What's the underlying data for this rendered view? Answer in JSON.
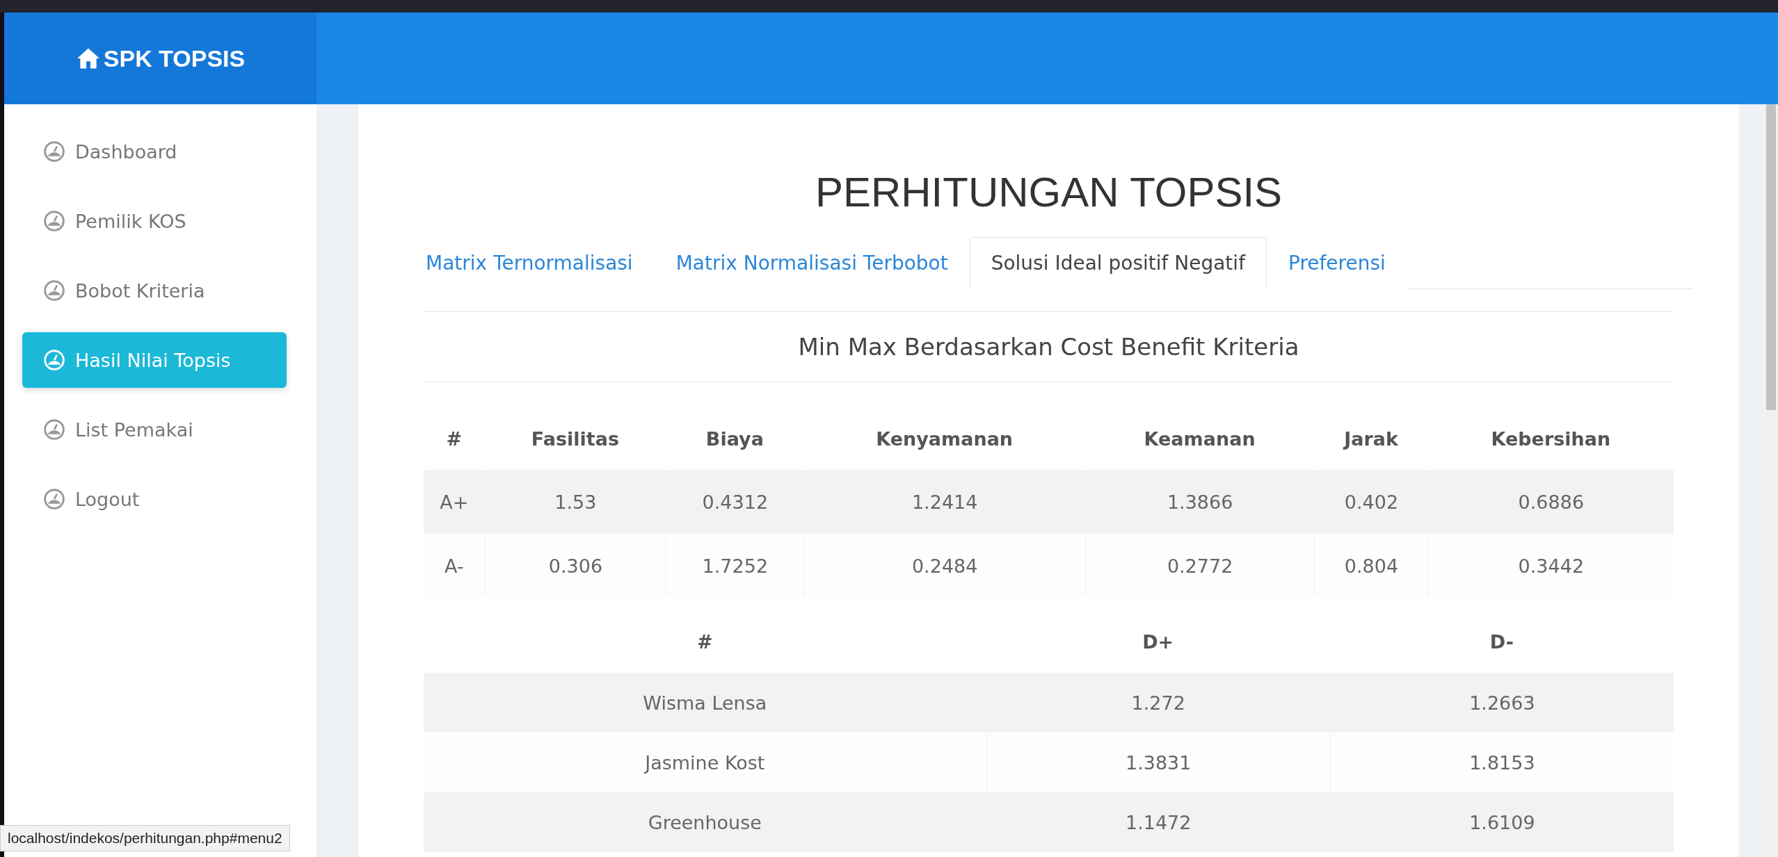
{
  "brand": {
    "title": "SPK TOPSIS"
  },
  "sidebar": {
    "items": [
      {
        "label": "Dashboard",
        "selected": false
      },
      {
        "label": "Pemilik KOS",
        "selected": false
      },
      {
        "label": "Bobot Kriteria",
        "selected": false
      },
      {
        "label": "Hasil Nilai Topsis",
        "selected": true
      },
      {
        "label": "List Pemakai",
        "selected": false
      },
      {
        "label": "Logout",
        "selected": false
      }
    ]
  },
  "page_title": "PERHITUNGAN TOPSIS",
  "tabs": [
    {
      "label": "Matrix Ternormalisasi",
      "selected": false
    },
    {
      "label": "Matrix Normalisasi Terbobot",
      "selected": false
    },
    {
      "label": "Solusi Ideal positif Negatif",
      "selected": true
    },
    {
      "label": "Preferensi",
      "selected": false
    }
  ],
  "section_title": "Min Max Berdasarkan Cost Benefit Kriteria",
  "ideal_table": {
    "columns": [
      "#",
      "Fasilitas",
      "Biaya",
      "Kenyamanan",
      "Keamanan",
      "Jarak",
      "Kebersihan"
    ],
    "rows": [
      [
        "A+",
        "1.53",
        "0.4312",
        "1.2414",
        "1.3866",
        "0.402",
        "0.6886"
      ],
      [
        "A-",
        "0.306",
        "1.7252",
        "0.2484",
        "0.2772",
        "0.804",
        "0.3442"
      ]
    ]
  },
  "distance_table": {
    "columns": [
      "#",
      "D+",
      "D-"
    ],
    "rows": [
      [
        "Wisma Lensa",
        "1.272",
        "1.2663"
      ],
      [
        "Jasmine Kost",
        "1.3831",
        "1.8153"
      ],
      [
        "Greenhouse",
        "1.1472",
        "1.6109"
      ]
    ]
  },
  "status_bar": {
    "url": "localhost/indekos/perhitungan.php#menu2"
  }
}
